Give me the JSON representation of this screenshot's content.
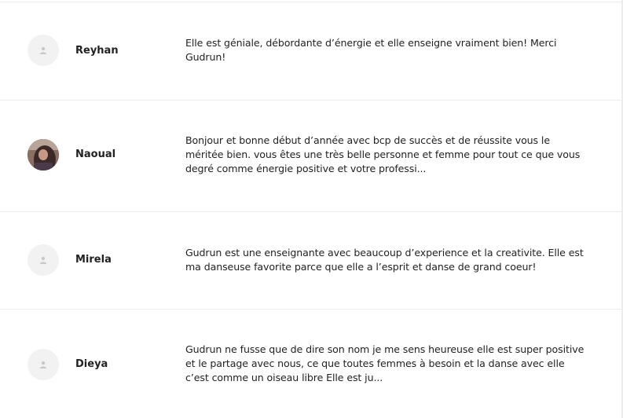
{
  "reviews": [
    {
      "name": "Reyhan",
      "avatar": "default-avatar-icon",
      "text": "Elle est géniale, débordante d’énergie et elle enseigne vraiment bien! Merci Gudrun!"
    },
    {
      "name": "Naoual",
      "avatar": "profile-photo",
      "text": "Bonjour et bonne début d’année avec bcp de succès et de réussite vous le méritée bien. vous êtes une très belle personne et femme pour tout ce que vous degré comme énergie positive et votre professi..."
    },
    {
      "name": "Mirela",
      "avatar": "default-avatar-icon",
      "text": "Gudrun est une enseignante avec beaucoup d’experience et la creativite. Elle est ma danseuse favorite parce que elle a l’esprit et danse de grand coeur!"
    },
    {
      "name": "Dieya",
      "avatar": "default-avatar-icon",
      "text": "Gudrun ne fusse que de dire son nom je me sens heureuse elle est super positive et le partage avec nous, ce que toutes femmes à besoin et la danse avec elle c’est comme un oiseau libre  Elle est ju..."
    }
  ],
  "colors": {
    "divider": "#ececec",
    "avatar_bg": "#f2f2f2",
    "avatar_icon": "#c8c8c8",
    "text": "#222222"
  }
}
